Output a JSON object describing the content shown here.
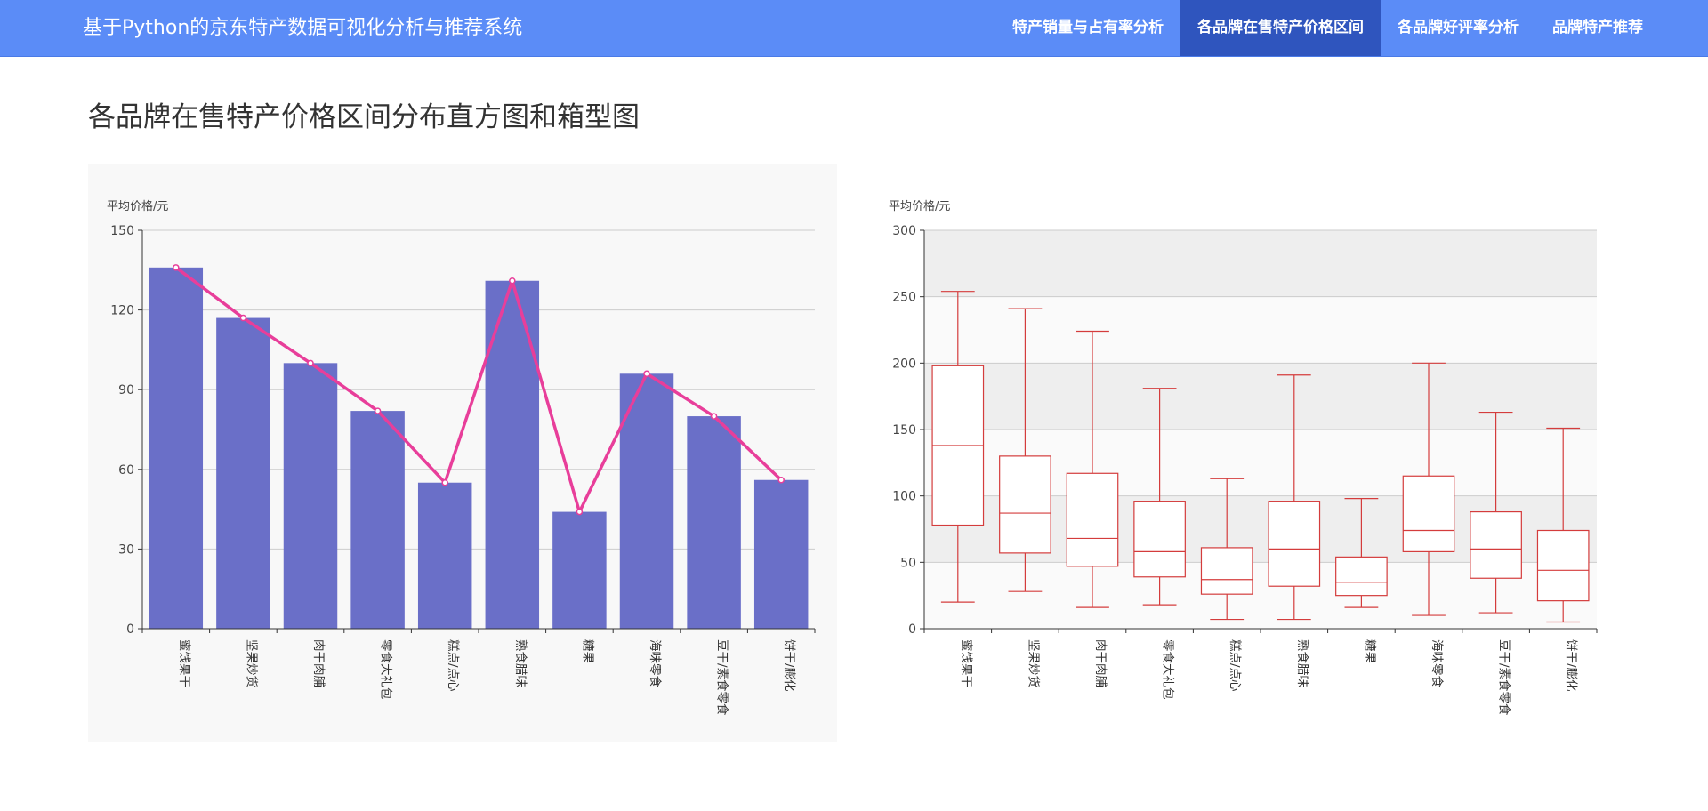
{
  "header": {
    "brand": "基于Python的京东特产数据可视化分析与推荐系统",
    "nav": [
      {
        "label": "特产销量与占有率分析",
        "active": false
      },
      {
        "label": "各品牌在售特产价格区间",
        "active": true
      },
      {
        "label": "各品牌好评率分析",
        "active": false
      },
      {
        "label": "品牌特产推荐",
        "active": false
      }
    ]
  },
  "page": {
    "title": "各品牌在售特产价格区间分布直方图和箱型图"
  },
  "colors": {
    "bar": "#6a6fc8",
    "line": "#e83e9a",
    "box": "#d43c3c",
    "navbar": "#5b8cf7",
    "nav_active": "#2f55be"
  },
  "chart_data": [
    {
      "type": "bar",
      "ylabel": "平均价格/元",
      "ylim": [
        0,
        150
      ],
      "yticks": [
        0,
        30,
        60,
        90,
        120,
        150
      ],
      "categories": [
        "蜜饯果干",
        "坚果炒货",
        "肉干肉脯",
        "零食大礼包",
        "糕点/点心",
        "熟食腊味",
        "糖果",
        "海味零食",
        "豆干/素食零食",
        "饼干/膨化"
      ],
      "values": [
        136,
        117,
        100,
        82,
        55,
        131,
        44,
        96,
        80,
        56
      ],
      "line_overlay": [
        136,
        117,
        100,
        82,
        55,
        131,
        44,
        96,
        80,
        56
      ],
      "grid": true
    },
    {
      "type": "boxplot",
      "ylabel": "平均价格/元",
      "ylim": [
        0,
        300
      ],
      "yticks": [
        0,
        50,
        100,
        150,
        200,
        250,
        300
      ],
      "categories": [
        "蜜饯果干",
        "坚果炒货",
        "肉干肉脯",
        "零食大礼包",
        "糕点/点心",
        "熟食腊味",
        "糖果",
        "海味零食",
        "豆干/素食零食",
        "饼干/膨化"
      ],
      "boxes": [
        [
          20,
          78,
          138,
          198,
          254
        ],
        [
          28,
          57,
          87,
          130,
          241
        ],
        [
          16,
          47,
          68,
          117,
          224
        ],
        [
          18,
          39,
          58,
          96,
          181
        ],
        [
          7,
          26,
          37,
          61,
          113
        ],
        [
          7,
          32,
          60,
          96,
          191
        ],
        [
          16,
          25,
          35,
          54,
          98
        ],
        [
          10,
          58,
          74,
          115,
          200
        ],
        [
          12,
          38,
          60,
          88,
          163
        ],
        [
          5,
          21,
          44,
          74,
          151
        ]
      ],
      "grid": true
    }
  ]
}
